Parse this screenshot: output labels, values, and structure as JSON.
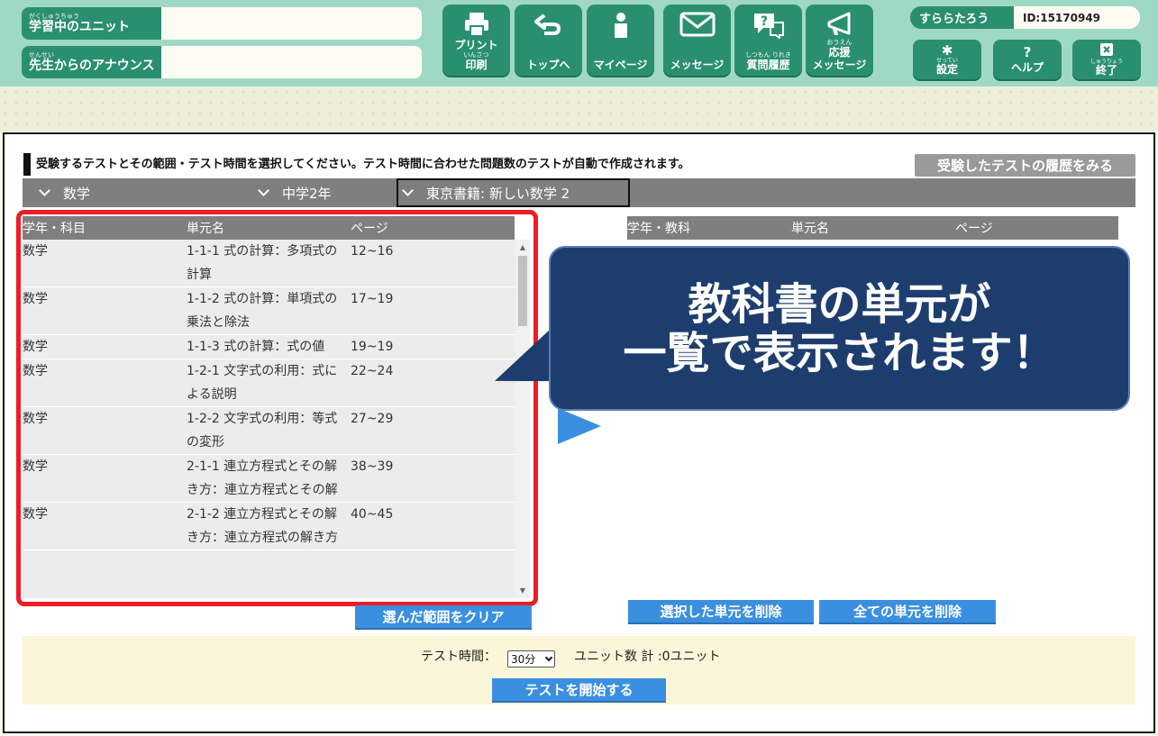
{
  "header": {
    "unit_label_ruby": "がくしゅうちゅう",
    "unit_label": "学習中のユニット",
    "announce_label_ruby": "せんせい",
    "announce_label": "先生からのアナウンス",
    "nav": [
      {
        "label": "プリント",
        "sub": "印刷",
        "ruby": "いんさつ",
        "icon": "printer-icon"
      },
      {
        "label": "トップへ",
        "ruby": "",
        "icon": "return-arrow-icon"
      },
      {
        "label": "マイページ",
        "ruby": "",
        "icon": "person-icon"
      },
      {
        "label": "メッセージ",
        "ruby": "",
        "icon": "envelope-icon"
      },
      {
        "label": "質問履歴",
        "ruby": "しつもん りれき",
        "icon": "question-bubble-icon"
      },
      {
        "label": "応援",
        "sub": "メッセージ",
        "ruby": "おうえん",
        "icon": "megaphone-icon"
      }
    ],
    "user_name": "すららたろう",
    "user_id": "ID:15170949",
    "utils": [
      {
        "label": "設定",
        "ruby": "せってい",
        "icon": "gear-icon"
      },
      {
        "label": "ヘルプ",
        "ruby": "",
        "icon": "question-icon"
      },
      {
        "label": "終了",
        "ruby": "しゅうりょう",
        "icon": "close-box-icon"
      }
    ]
  },
  "main": {
    "instruction": "受験するテストとその範囲・テスト時間を選択してください。テスト時間に合わせた問題数のテストが自動で作成されます。",
    "history_button": "受験したテストの履歴をみる",
    "filters": [
      "数学",
      "中学2年",
      "東京書籍: 新しい数学 2"
    ],
    "left_table": {
      "headers": [
        "学年・科目",
        "単元名",
        "ページ"
      ],
      "rows": [
        {
          "subject": "数学",
          "unit": "1-1-1 式の計算：多項式の計算",
          "pages": "12~16"
        },
        {
          "subject": "数学",
          "unit": "1-1-2 式の計算：単項式の乗法と除法",
          "pages": "17~19"
        },
        {
          "subject": "数学",
          "unit": "1-1-3 式の計算：式の値",
          "pages": "19~19"
        },
        {
          "subject": "数学",
          "unit": "1-2-1 文字式の利用：式による説明",
          "pages": "22~24"
        },
        {
          "subject": "数学",
          "unit": "1-2-2 文字式の利用：等式の変形",
          "pages": "27~29"
        },
        {
          "subject": "数学",
          "unit": "2-1-1 連立方程式とその解き方：連立方程式とその解",
          "pages": "38~39"
        },
        {
          "subject": "数学",
          "unit": "2-1-2 連立方程式とその解き方：連立方程式の解き方",
          "pages": "40~45"
        }
      ]
    },
    "right_table": {
      "headers": [
        "学年・教科",
        "単元名",
        "ページ"
      ]
    },
    "clear_button": "選んだ範囲をクリア",
    "delete_selected_button": "選択した単元を削除",
    "delete_all_button": "全ての単元を削除",
    "time_label": "テスト時間：",
    "time_value": "30分",
    "units_total": "ユニット数 計 :0ユニット",
    "start_button": "テストを開始する"
  },
  "callout": {
    "line1": "教科書の単元が",
    "line2": "一覧で表示されます！"
  },
  "colors": {
    "header_bg": "#9fd9c5",
    "brand_green": "#2a8f6f",
    "accent_blue": "#3b8fe0",
    "callout_navy": "#1e3d6f",
    "highlight_red": "#ee1c24"
  }
}
